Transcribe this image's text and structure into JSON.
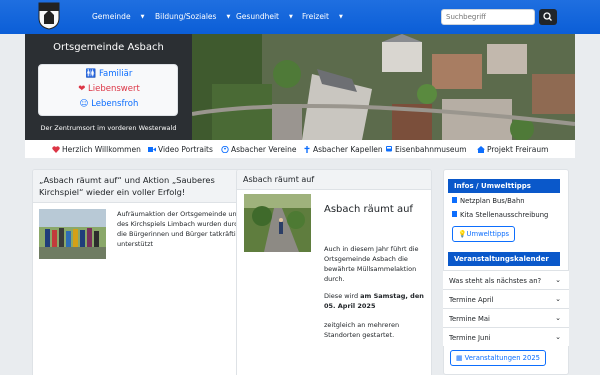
{
  "nav": {
    "items": [
      "Gemeinde",
      "Bildung/Soziales",
      "Gesundheit",
      "Freizeit"
    ],
    "search_placeholder": "Suchbegriff"
  },
  "hero": {
    "title": "Ortsgemeinde Asbach",
    "lines": [
      "🚻 Familiär",
      "❤ Liebenswert",
      "☺ Lebensfroh"
    ],
    "subtitle": "Der Zentrumsort im vorderen Westerwald"
  },
  "links": [
    "Herzlich Willkommen",
    "Video Portraits",
    "Asbacher Vereine",
    "Asbacher Kapellen",
    "Eisenbahnmuseum",
    "Projekt Freiraum"
  ],
  "card1": {
    "title": "„Asbach räumt auf“ und Aktion „Sauberes Kirchspiel“ wieder ein voller Erfolg!",
    "text": "Aufräumaktion der Ortsgemeinde und des Kirchspiels Limbach wurden durch die Bürgerinnen und Bürger tatkräftig unterstützt"
  },
  "card2": {
    "header": "Asbach räumt auf",
    "heading": "Asbach räumt auf",
    "para1": "Auch in diesem Jahr führt die Ortsgemeinde Asbach die bewährte Müllsammelaktion durch.",
    "date_prefix": "Diese wird",
    "date_bold": "am Samstag, den 05. April 2025",
    "para2": "zeitgleich an mehreren Standorten gestartet."
  },
  "sidebar": {
    "info_title": "Infos / Umwelttipps",
    "links": [
      "Netzplan Bus/Bahn",
      "Kita Stellenausschreibung"
    ],
    "umwelt_button": "Umwelttipps",
    "calendar_title": "Veranstaltungskalender",
    "accordion": [
      "Was steht als nächstes an?",
      "Termine April",
      "Termine Mai",
      "Termine Juni"
    ],
    "events_button": "Veranstaltungen 2025"
  },
  "colors": {
    "primary": "#0d6efd",
    "heart": "#dc3545"
  }
}
